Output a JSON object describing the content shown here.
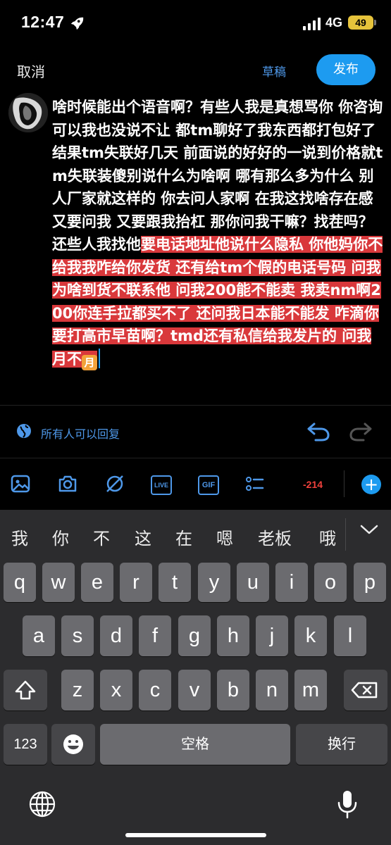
{
  "status_bar": {
    "time": "12:47",
    "network": "4G",
    "battery": "49"
  },
  "compose": {
    "cancel_label": "取消",
    "drafts_label": "草稿",
    "post_label": "发布",
    "text_before": "啥时候能出个语音啊？有些人我是真想骂你 你咨询可以我也没说不让 都tm聊好了我东西都打包好了 结果tm失联好几天 前面说的好好的一说到价格就tm失联装傻别说什么为啥啊 哪有那么多为什么 别人厂家就这样的 你去问人家啊 在我这找啥存在感 又要问我 又要跟我抬杠 那你问我干嘛？找茬吗？还些人我找他",
    "text_over": "要电话地址他说什么隐私 你他妈你不给我我咋给你发货 还有给tm个假的电话号码 问我为啥到货不联系他 问我200能不能卖 我卖nm啊200你连手拉都买不了 还问我日本能不能发 咋滴你要打高市早苗啊？tmd还有私信给我发片的 问我月不",
    "emoji": "月"
  },
  "reply_setting": {
    "label": "所有人可以回复"
  },
  "toolbar": {
    "char_count": "-214",
    "live_label": "LIVE",
    "gif_label": "GIF",
    "add_label": "+"
  },
  "keyboard": {
    "candidates": [
      "我",
      "你",
      "不",
      "这",
      "在",
      "嗯",
      "老板",
      "哦"
    ],
    "row1": [
      "q",
      "w",
      "e",
      "r",
      "t",
      "y",
      "u",
      "i",
      "o",
      "p"
    ],
    "row2": [
      "a",
      "s",
      "d",
      "f",
      "g",
      "h",
      "j",
      "k",
      "l"
    ],
    "row3": [
      "z",
      "x",
      "c",
      "v",
      "b",
      "n",
      "m"
    ],
    "numbers_label": "123",
    "space_label": "空格",
    "return_label": "换行"
  },
  "colors": {
    "accent": "#1d9bf0",
    "selection": "#d9383b",
    "count_warning": "#f0413c"
  }
}
